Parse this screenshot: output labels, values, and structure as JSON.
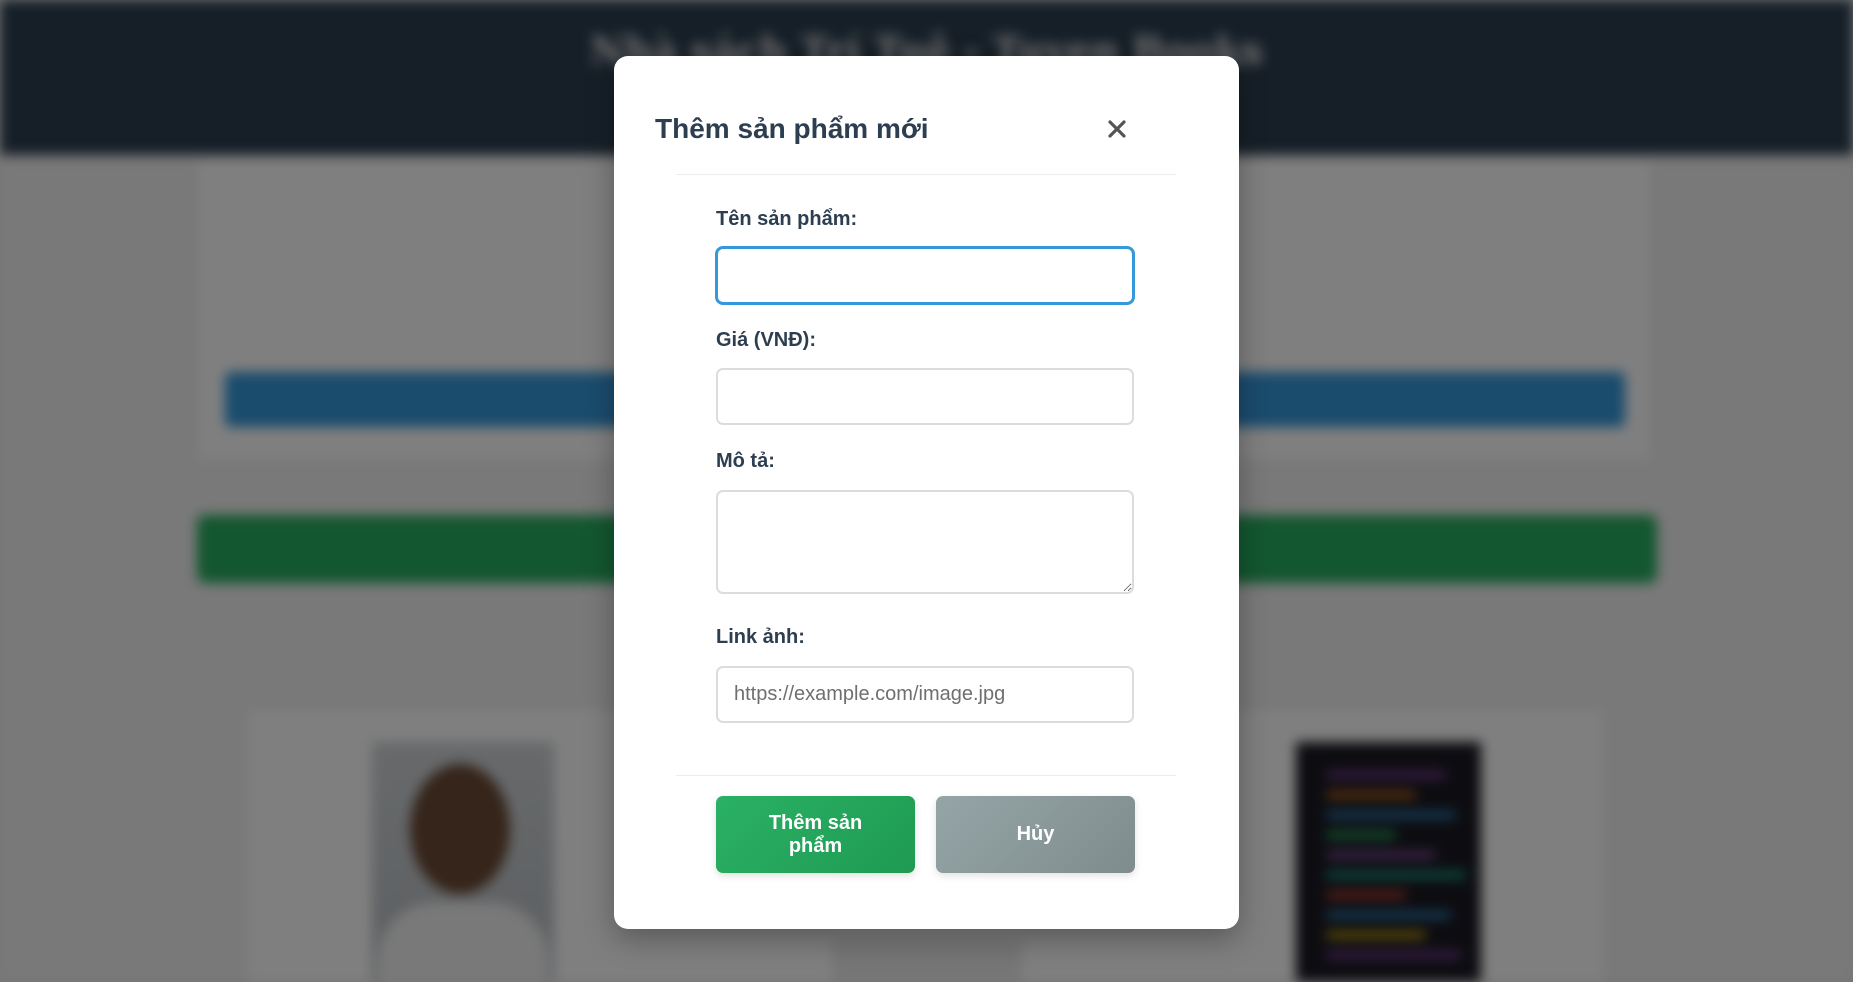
{
  "background": {
    "header_title": "Nhà sách Trí Tuệ - Tuyen Books"
  },
  "modal": {
    "title": "Thêm sản phẩm mới",
    "close_icon": "close-icon",
    "fields": {
      "name": {
        "label": "Tên sản phẩm:",
        "value": "",
        "placeholder": ""
      },
      "price": {
        "label": "Giá (VNĐ):",
        "value": "",
        "placeholder": ""
      },
      "description": {
        "label": "Mô tả:",
        "value": "",
        "placeholder": ""
      },
      "image_link": {
        "label": "Link ảnh:",
        "value": "",
        "placeholder": "https://example.com/image.jpg"
      }
    },
    "buttons": {
      "submit_label": "Thêm sản phẩm",
      "cancel_label": "Hủy"
    }
  },
  "colors": {
    "header_bg": "#2c3e50",
    "title_text": "#2c3e50",
    "focus_border": "#3498db",
    "submit_button": "#27ae60",
    "cancel_button": "#8a9a9b",
    "overlay": "rgba(0,0,0,0.5)"
  }
}
